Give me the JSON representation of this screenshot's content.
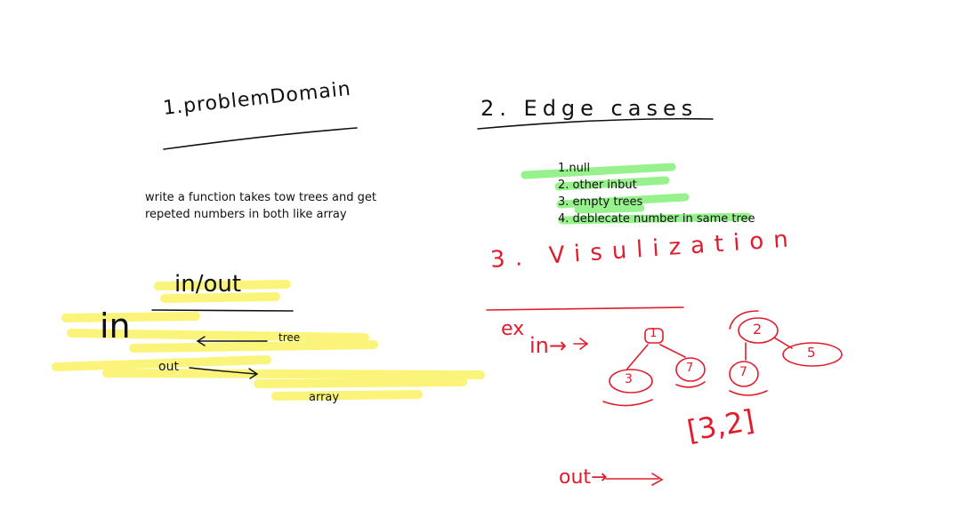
{
  "sections": {
    "problem_domain": {
      "title": "1.problemDomain",
      "text": "write  a function takes tow trees and get\nrepeted numbers in both like array"
    },
    "edge_cases": {
      "title": "2. Edge cases",
      "items": [
        "1.null",
        "2. other inbut",
        "3. empty trees",
        "4. deblecate number in same tree"
      ],
      "highlight_color": "#86ef7a"
    },
    "in_out": {
      "title": "in/out",
      "in_label": "in",
      "in_value": "tree",
      "out_label": "out",
      "out_value": "array",
      "highlight_color": "#fbf25a"
    },
    "visualization": {
      "title": "3. Visulization",
      "ex_label": "ex",
      "in_label": "in→",
      "tree1_nodes": [
        "1",
        "3",
        "7"
      ],
      "tree2_nodes": [
        "2",
        "5",
        "7"
      ],
      "out_label": "out→",
      "result": "[3,2]",
      "ink_color": "#e01d2c"
    }
  }
}
